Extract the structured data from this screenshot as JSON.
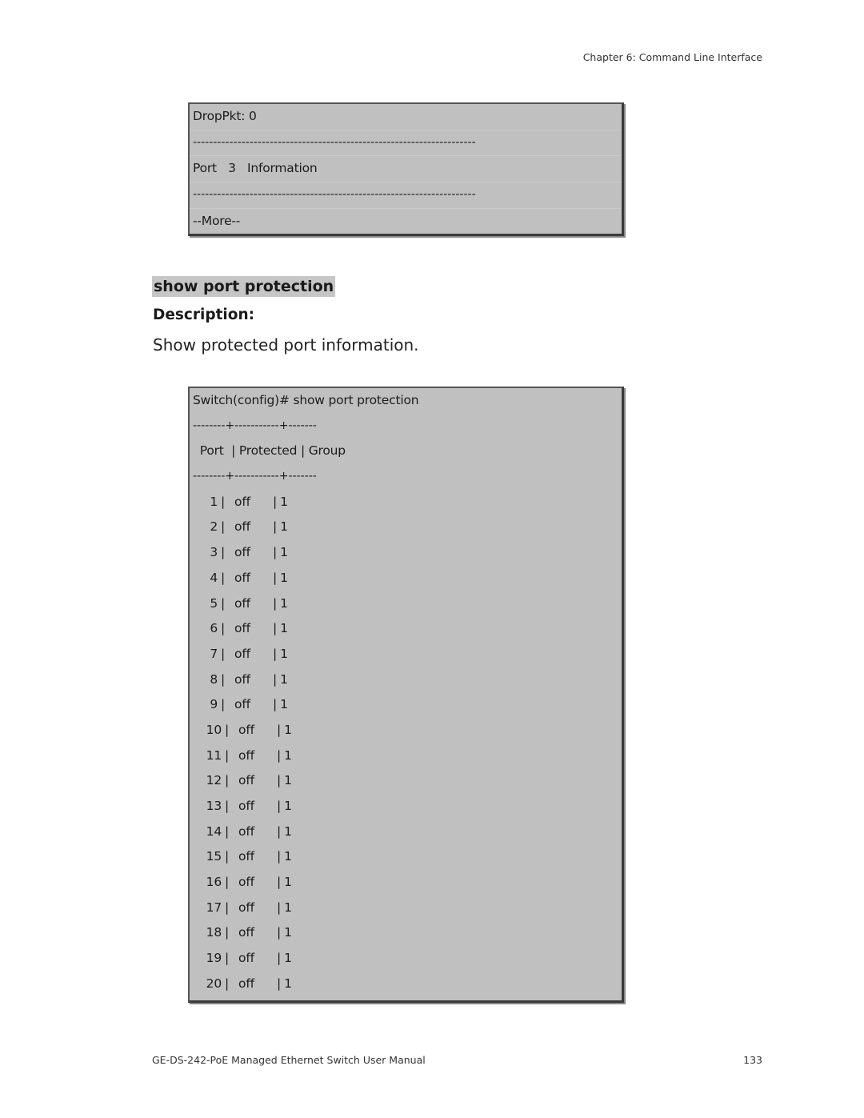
{
  "header": {
    "chapter": "Chapter 6: Command Line Interface"
  },
  "box1": {
    "lines": [
      "DropPkt: 0",
      "----------------------------------------------------------------------",
      "Port   3   Information",
      "----------------------------------------------------------------------",
      "--More--"
    ]
  },
  "section": {
    "command": "show port protection",
    "description_label": "Description:",
    "description_text": "Show protected port information."
  },
  "box2": {
    "prompt_line": "Switch(config)# show port protection",
    "divider": "--------+-----------+-------",
    "header": " Port  | Protected | Group",
    "rows": [
      {
        "port": "1",
        "protected": "off",
        "group": "1"
      },
      {
        "port": "2",
        "protected": "off",
        "group": "1"
      },
      {
        "port": "3",
        "protected": "off",
        "group": "1"
      },
      {
        "port": "4",
        "protected": "off",
        "group": "1"
      },
      {
        "port": "5",
        "protected": "off",
        "group": "1"
      },
      {
        "port": "6",
        "protected": "off",
        "group": "1"
      },
      {
        "port": "7",
        "protected": "off",
        "group": "1"
      },
      {
        "port": "8",
        "protected": "off",
        "group": "1"
      },
      {
        "port": "9",
        "protected": "off",
        "group": "1"
      },
      {
        "port": "10",
        "protected": "off",
        "group": "1"
      },
      {
        "port": "11",
        "protected": "off",
        "group": "1"
      },
      {
        "port": "12",
        "protected": "off",
        "group": "1"
      },
      {
        "port": "13",
        "protected": "off",
        "group": "1"
      },
      {
        "port": "14",
        "protected": "off",
        "group": "1"
      },
      {
        "port": "15",
        "protected": "off",
        "group": "1"
      },
      {
        "port": "16",
        "protected": "off",
        "group": "1"
      },
      {
        "port": "17",
        "protected": "off",
        "group": "1"
      },
      {
        "port": "18",
        "protected": "off",
        "group": "1"
      },
      {
        "port": "19",
        "protected": "off",
        "group": "1"
      },
      {
        "port": "20",
        "protected": "off",
        "group": "1"
      }
    ]
  },
  "footer": {
    "manual_title": "GE-DS-242-PoE Managed Ethernet Switch User Manual",
    "page_number": "133"
  }
}
